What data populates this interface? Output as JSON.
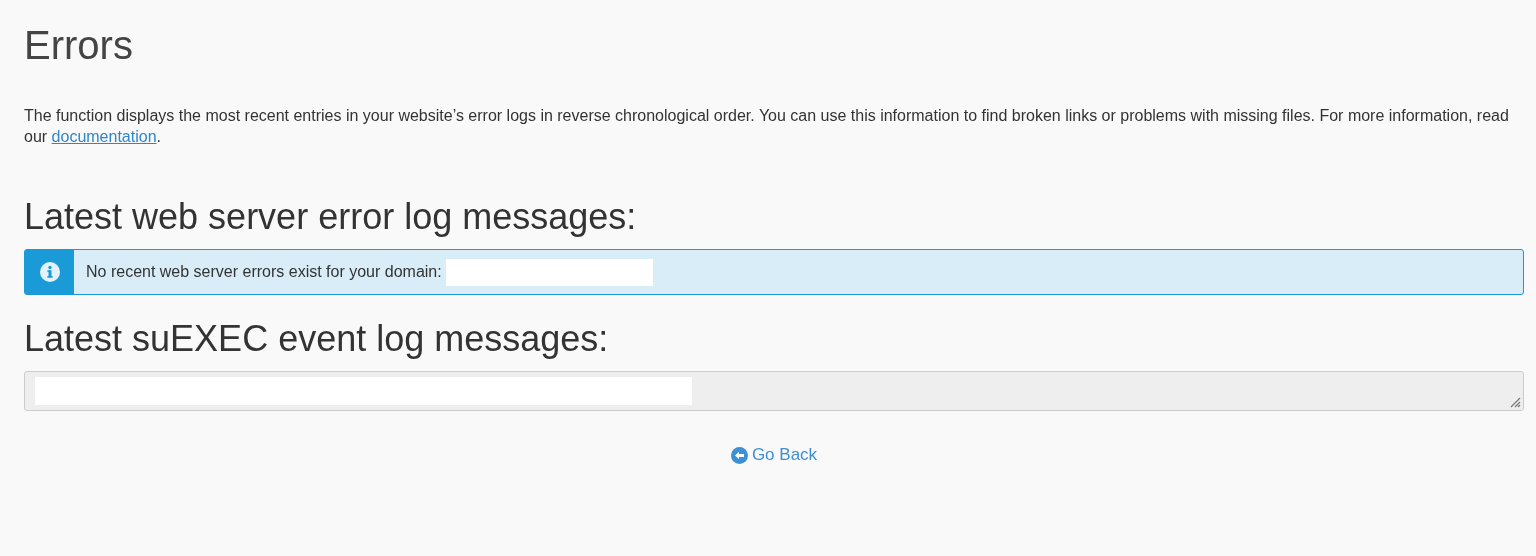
{
  "title": "Errors",
  "description": {
    "text": "The function displays the most recent entries in your website’s error logs in reverse chronological order. You can use this information to find broken links or problems with missing files. For more information, read our ",
    "link": "documentation",
    "after": "."
  },
  "sections": [
    {
      "heading": "Latest web server error log messages:",
      "kind": "alert",
      "message": "No recent web server errors exist for your domain:"
    },
    {
      "heading": "Latest suEXEC event log messages:",
      "kind": "log",
      "disabled": true
    }
  ],
  "go_back": "Go Back"
}
